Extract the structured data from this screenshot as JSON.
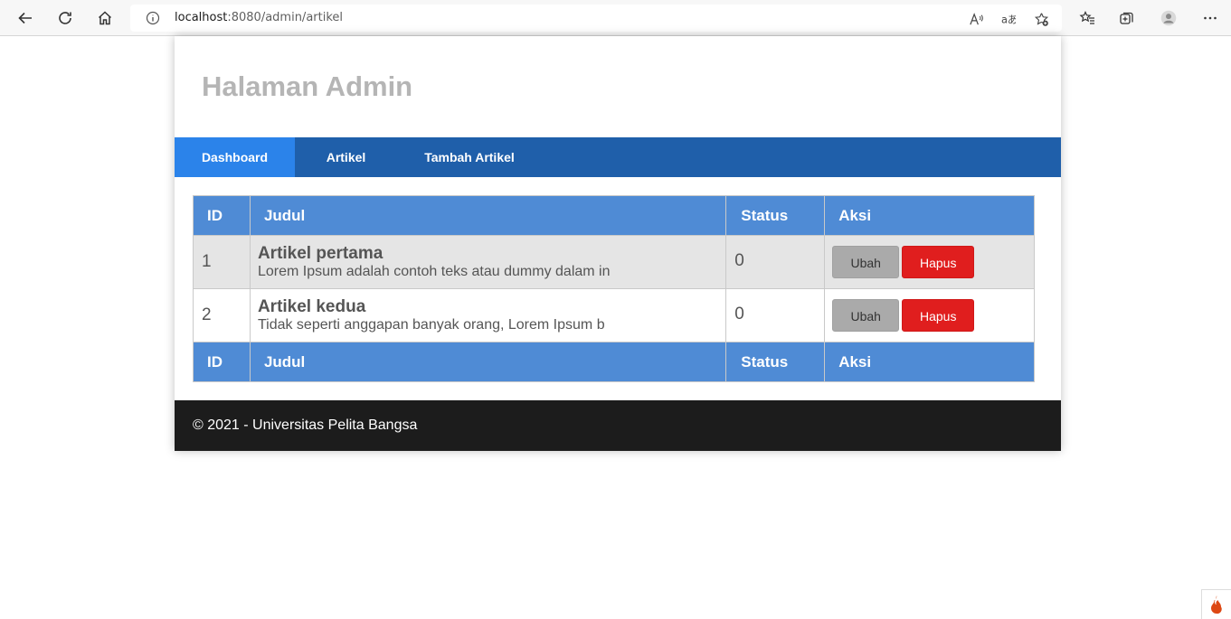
{
  "browser": {
    "url_host": "localhost",
    "url_path": ":8080/admin/artikel",
    "icons": [
      "back-icon",
      "refresh-icon",
      "home-icon",
      "info-icon",
      "read-aloud-icon",
      "translate-icon",
      "add-favorite-icon",
      "favorites-icon",
      "collections-icon",
      "profile-icon",
      "more-icon"
    ]
  },
  "header": {
    "title": "Halaman Admin"
  },
  "nav": {
    "items": [
      {
        "label": "Dashboard",
        "active": true
      },
      {
        "label": "Artikel",
        "active": false
      },
      {
        "label": "Tambah Artikel",
        "active": false
      }
    ]
  },
  "table": {
    "columns": [
      "ID",
      "Judul",
      "Status",
      "Aksi"
    ],
    "rows": [
      {
        "id": "1",
        "title": "Artikel pertama",
        "excerpt": "Lorem Ipsum adalah contoh teks atau dummy dalam in",
        "status": "0",
        "edit_label": "Ubah",
        "delete_label": "Hapus"
      },
      {
        "id": "2",
        "title": "Artikel kedua",
        "excerpt": "Tidak seperti anggapan banyak orang, Lorem Ipsum b",
        "status": "0",
        "edit_label": "Ubah",
        "delete_label": "Hapus"
      }
    ]
  },
  "footer": {
    "text": "© 2021 - Universitas Pelita Bangsa"
  },
  "colors": {
    "nav_bg": "#1f5faa",
    "nav_active": "#2b83ea",
    "table_header": "#4f8bd5",
    "delete_button": "#e01e1e",
    "edit_button": "#aaaaaa",
    "footer_bg": "#1c1c1c"
  }
}
